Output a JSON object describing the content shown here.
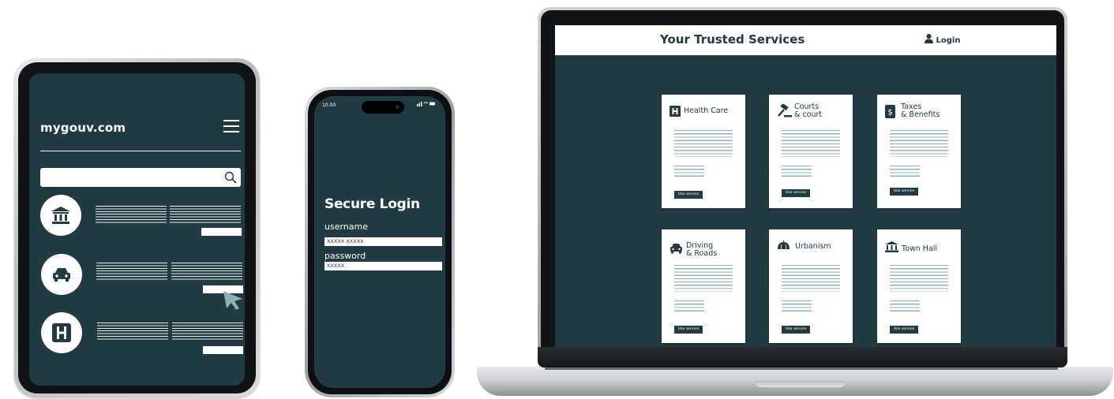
{
  "tablet": {
    "brand": "mygouv.com",
    "icons": [
      "bank-icon",
      "car-icon",
      "hospital-icon",
      "search-icon",
      "menu-icon",
      "cursor-icon"
    ]
  },
  "phone": {
    "time": "10.00",
    "title": "Secure Login",
    "username_label": "username",
    "username_value": "XXXXX XXXXX",
    "password_label": "password",
    "password_value": "XXXXX"
  },
  "laptop": {
    "site_title": "Your Trusted Services",
    "login_label": "Login",
    "cards": [
      {
        "title_line1": "Health Care",
        "title_line2": "",
        "icon": "hospital-icon",
        "button": "Use service"
      },
      {
        "title_line1": "Courts",
        "title_line2": "& court",
        "icon": "gavel-icon",
        "button": "Use service"
      },
      {
        "title_line1": "Taxes",
        "title_line2": "& Benefits",
        "icon": "dollar-icon",
        "button": "Use service"
      },
      {
        "title_line1": "Driving",
        "title_line2": "& Roads",
        "icon": "car-icon",
        "button": "Use service"
      },
      {
        "title_line1": "Urbanism",
        "title_line2": "",
        "icon": "dome-icon",
        "button": "Use service"
      },
      {
        "title_line1": "Town Hall",
        "title_line2": "",
        "icon": "townhall-icon",
        "button": "Use service"
      }
    ]
  },
  "colors": {
    "primary": "#223a42",
    "accent_lines": "#8fb0b3",
    "background": "#ffffff"
  }
}
